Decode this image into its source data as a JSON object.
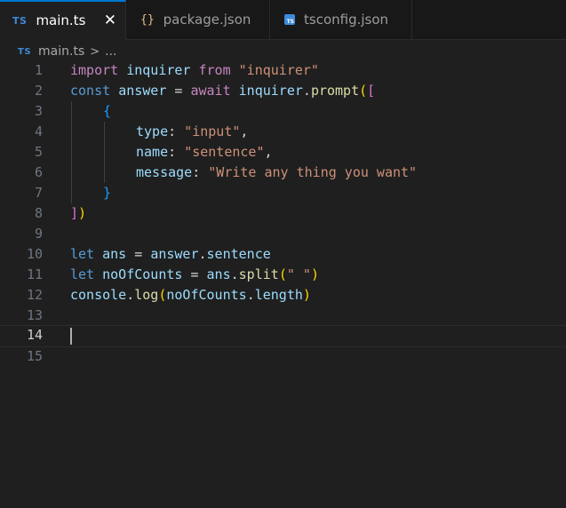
{
  "tabs": [
    {
      "label": "main.ts",
      "badge": "TS",
      "active": true,
      "close": "✕"
    },
    {
      "label": "package.json",
      "badge": "{}",
      "active": false
    },
    {
      "label": "tsconfig.json",
      "badge": "TS",
      "active": false
    }
  ],
  "breadcrumb": {
    "badge": "TS",
    "file": "main.ts",
    "separator": ">",
    "more": "..."
  },
  "editor": {
    "current_line": 14,
    "line_numbers": [
      "1",
      "2",
      "3",
      "4",
      "5",
      "6",
      "7",
      "8",
      "9",
      "10",
      "11",
      "12",
      "13",
      "14",
      "15"
    ],
    "tokens": {
      "l1": [
        "import",
        " ",
        "inquirer",
        " ",
        "from",
        " ",
        "\"inquirer\""
      ],
      "l2": [
        "const",
        " ",
        "answer",
        " = ",
        "await",
        " ",
        "inquirer",
        ".",
        "prompt",
        "(",
        "["
      ],
      "l3": [
        "{"
      ],
      "l4": [
        "type",
        ": ",
        "\"input\"",
        ","
      ],
      "l5": [
        "name",
        ": ",
        "\"sentence\"",
        ","
      ],
      "l6": [
        "message",
        ": ",
        "\"Write any thing you want\""
      ],
      "l7": [
        "}"
      ],
      "l8": [
        "]",
        ")"
      ],
      "l10": [
        "let",
        " ",
        "ans",
        " = ",
        "answer",
        ".",
        "sentence"
      ],
      "l11": [
        "let",
        " ",
        "noOfCounts",
        " = ",
        "ans",
        ".",
        "split",
        "(",
        "\" \"",
        ")"
      ],
      "l12": [
        "console",
        ".",
        "log",
        "(",
        "noOfCounts",
        ".",
        "length",
        ")"
      ]
    }
  },
  "colors": {
    "background": "#1f1f1f",
    "tab_accent": "#0078d4",
    "keyword_import": "#c586c0",
    "keyword": "#569cd6",
    "variable": "#9cdcfe",
    "string": "#ce9178",
    "function": "#dcdcaa"
  },
  "icons": {
    "close": "close-icon",
    "ts": "typescript-icon",
    "json": "json-icon"
  }
}
